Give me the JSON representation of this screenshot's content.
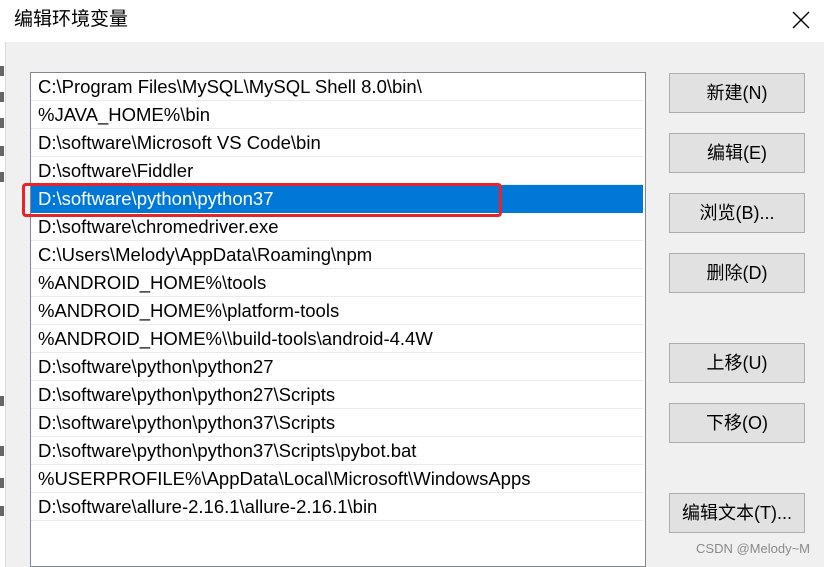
{
  "window": {
    "title": "编辑环境变量"
  },
  "list": {
    "items": [
      "C:\\Program Files\\MySQL\\MySQL Shell 8.0\\bin\\",
      "%JAVA_HOME%\\bin",
      "D:\\software\\Microsoft VS Code\\bin",
      "D:\\software\\Fiddler",
      "D:\\software\\python\\python37",
      "D:\\software\\chromedriver.exe",
      "C:\\Users\\Melody\\AppData\\Roaming\\npm",
      "%ANDROID_HOME%\\tools",
      "%ANDROID_HOME%\\platform-tools",
      "%ANDROID_HOME%\\\\build-tools\\android-4.4W",
      "D:\\software\\python\\python27",
      "D:\\software\\python\\python27\\Scripts",
      "D:\\software\\python\\python37\\Scripts",
      "D:\\software\\python\\python37\\Scripts\\pybot.bat",
      "%USERPROFILE%\\AppData\\Local\\Microsoft\\WindowsApps",
      "D:\\software\\allure-2.16.1\\allure-2.16.1\\bin"
    ],
    "selected_index": 4
  },
  "buttons": {
    "new": "新建(N)",
    "edit": "编辑(E)",
    "browse": "浏览(B)...",
    "delete": "删除(D)",
    "move_up": "上移(U)",
    "move_down": "下移(O)",
    "edit_text": "编辑文本(T)..."
  },
  "watermark": "CSDN @Melody~M",
  "colors": {
    "selection": "#0078d7",
    "annotation": "#e8242a"
  }
}
